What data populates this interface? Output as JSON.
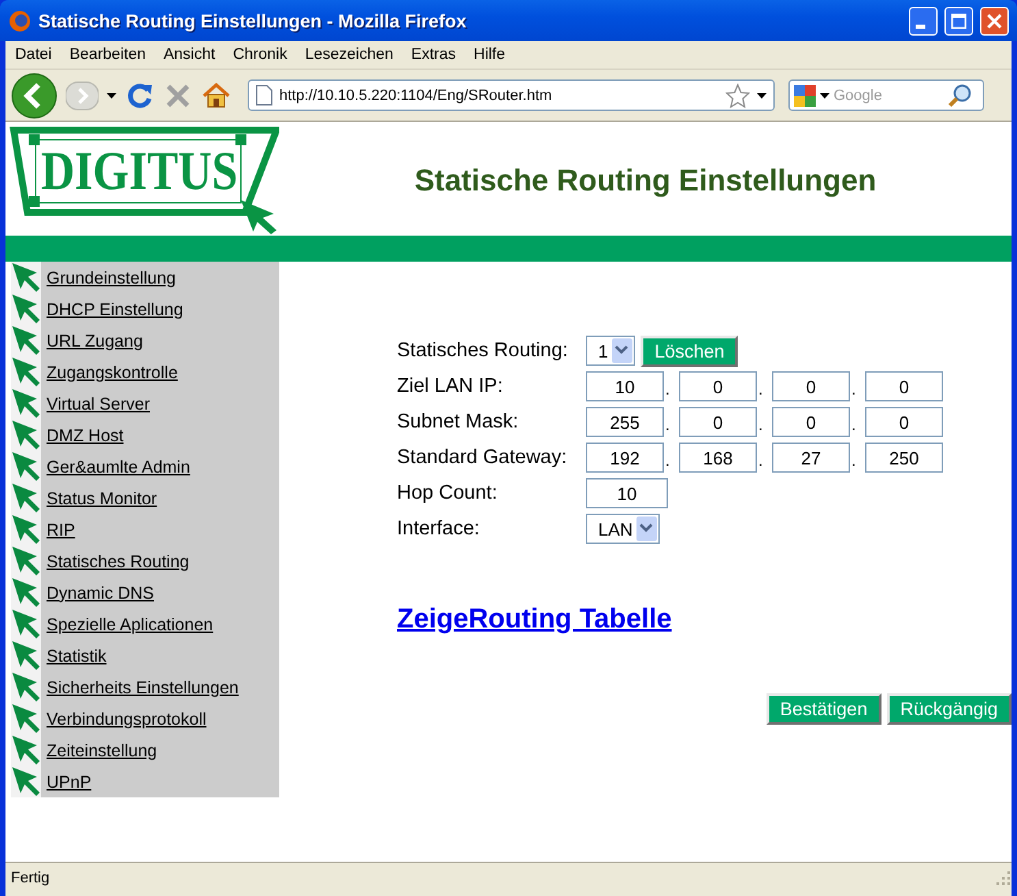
{
  "window": {
    "title": "Statische Routing Einstellungen - Mozilla Firefox"
  },
  "menu": [
    "Datei",
    "Bearbeiten",
    "Ansicht",
    "Chronik",
    "Lesezeichen",
    "Extras",
    "Hilfe"
  ],
  "toolbar": {
    "url": "http://10.10.5.220:1104/Eng/SRouter.htm",
    "search_placeholder": "Google"
  },
  "header": {
    "logo": "DIGITUS",
    "heading": "Statische Routing Einstellungen"
  },
  "sidebar": {
    "items": [
      "Grundeinstellung",
      "DHCP Einstellung",
      "URL Zugang",
      "Zugangskontrolle",
      "Virtual Server",
      "DMZ Host",
      "Ger&aumlte Admin",
      "Status Monitor",
      "RIP",
      "Statisches Routing",
      "Dynamic DNS",
      "Spezielle Aplicationen",
      "Statistik",
      "Sicherheits Einstellungen",
      "Verbindungsprotokoll",
      "Zeiteinstellung",
      "UPnP"
    ]
  },
  "form": {
    "rows": [
      {
        "kind": "select",
        "label": "Statisches Routing:",
        "value": "1",
        "button": "Löschen"
      },
      {
        "kind": "ip",
        "label": "Ziel LAN IP:",
        "values": [
          "10",
          "0",
          "0",
          "0"
        ],
        "separators": [
          ".",
          ".",
          "."
        ]
      },
      {
        "kind": "ip",
        "label": "Subnet Mask:",
        "values": [
          "255",
          "0",
          "0",
          "0"
        ],
        "separators": [
          ".",
          ".",
          "."
        ]
      },
      {
        "kind": "ip",
        "label": "Standard Gateway:",
        "values": [
          "192",
          "168",
          "27",
          "250"
        ],
        "separators": [
          ".",
          ".",
          "."
        ]
      },
      {
        "kind": "text",
        "label": "Hop Count:",
        "value": "10"
      },
      {
        "kind": "select",
        "label": "Interface:",
        "value": "LAN"
      }
    ],
    "link": "ZeigeRouting Tabelle",
    "buttons": [
      "Bestätigen",
      "Rückgängig"
    ]
  },
  "status_bar": {
    "text": "Fertig"
  }
}
